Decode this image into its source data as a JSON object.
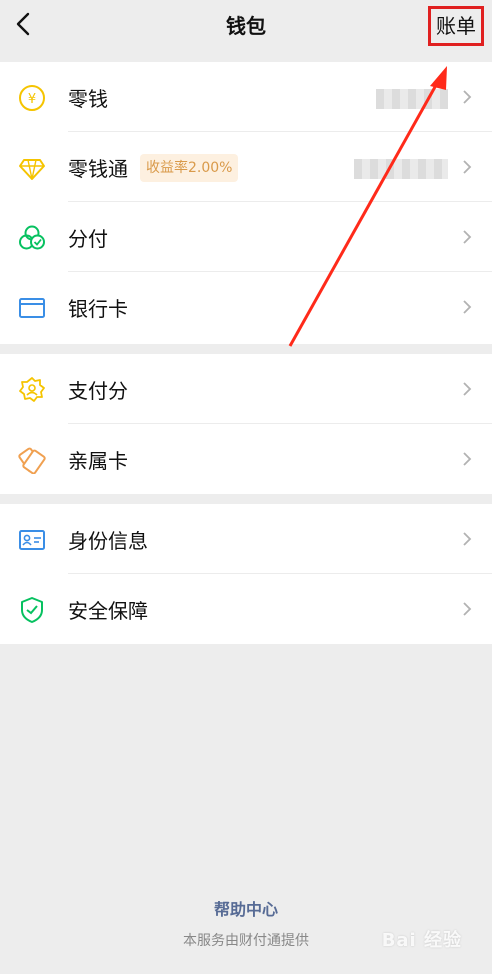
{
  "header": {
    "title": "钱包",
    "bill_label": "账单"
  },
  "group1": {
    "change": {
      "label": "零钱"
    },
    "lingqiantong": {
      "label": "零钱通",
      "badge": "收益率2.00%"
    },
    "fenfu": {
      "label": "分付"
    },
    "bank_card": {
      "label": "银行卡"
    }
  },
  "group2": {
    "pay_score": {
      "label": "支付分"
    },
    "family_card": {
      "label": "亲属卡"
    }
  },
  "group3": {
    "identity": {
      "label": "身份信息"
    },
    "security": {
      "label": "安全保障"
    }
  },
  "footer": {
    "help": "帮助中心",
    "note": "本服务由财付通提供"
  },
  "watermark": "Bai 经验",
  "colors": {
    "accent_green": "#1aad19",
    "badge_text": "#d99a4a",
    "link_blue": "#576b95",
    "highlight_red": "#e02020"
  }
}
